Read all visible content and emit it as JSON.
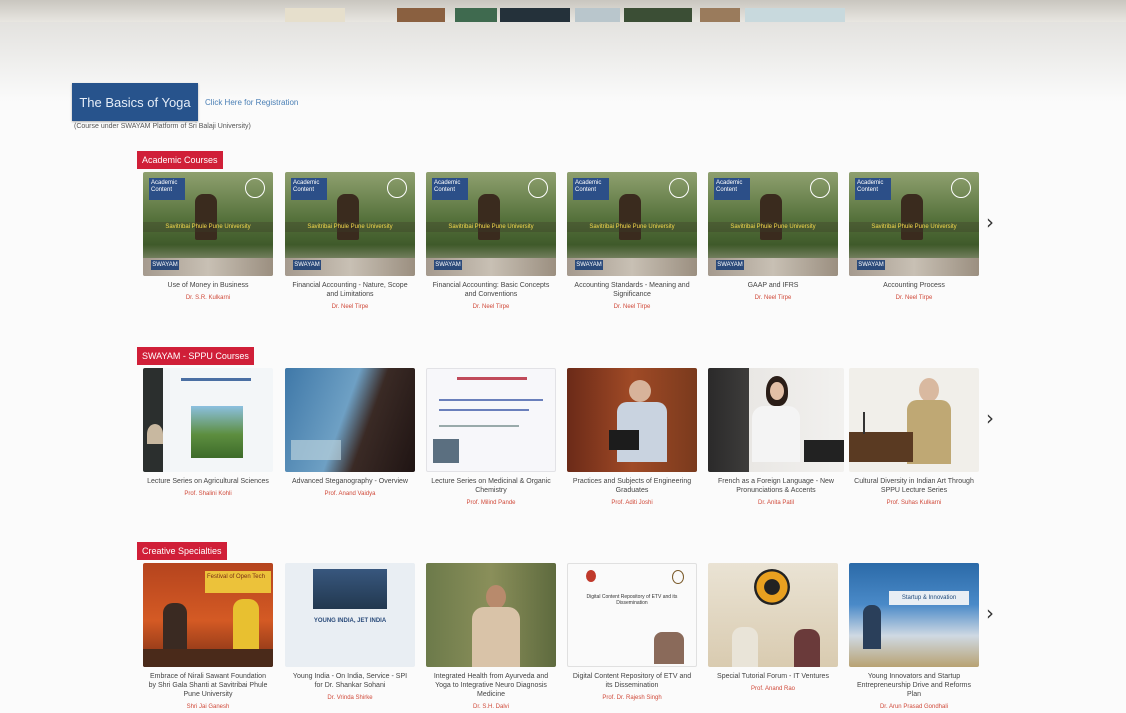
{
  "featured": {
    "banner_title": "The Basics of Yoga",
    "register_link": "Click Here for Registration",
    "subtitle": "(Course under SWAYAM Platform of Sri Balaji University)"
  },
  "sections": [
    {
      "label": "Academic Courses",
      "cards": [
        {
          "title": "Use of Money in Business",
          "author": "Dr. S.R. Kulkarni",
          "badge": "Academic Content",
          "band": "Savitribai Phule Pune University",
          "logo": "SWAYAM"
        },
        {
          "title": "Financial Accounting - Nature, Scope and Limitations",
          "author": "Dr. Neel Tirpe",
          "badge": "Academic Content",
          "band": "Savitribai Phule Pune University",
          "logo": "SWAYAM"
        },
        {
          "title": "Financial Accounting: Basic Concepts and Conventions",
          "author": "Dr. Neel Tirpe",
          "badge": "Academic Content",
          "band": "Savitribai Phule Pune University",
          "logo": "SWAYAM"
        },
        {
          "title": "Accounting Standards - Meaning and Significance",
          "author": "Dr. Neel Tirpe",
          "badge": "Academic Content",
          "band": "Savitribai Phule Pune University",
          "logo": "SWAYAM"
        },
        {
          "title": "GAAP and IFRS",
          "author": "Dr. Neel Tirpe",
          "badge": "Academic Content",
          "band": "Savitribai Phule Pune University",
          "logo": "SWAYAM"
        },
        {
          "title": "Accounting Process",
          "author": "Dr. Neel Tirpe",
          "badge": "Academic Content",
          "band": "Savitribai Phule Pune University",
          "logo": "SWAYAM"
        }
      ]
    },
    {
      "label": "SWAYAM - SPPU Courses",
      "cards": [
        {
          "title": "Lecture Series on Agricultural Sciences",
          "author": "Prof. Shalini Kohli"
        },
        {
          "title": "Advanced Steganography - Overview",
          "author": "Prof. Anand Vaidya"
        },
        {
          "title": "Lecture Series on Medicinal & Organic Chemistry",
          "author": "Prof. Milind Pande"
        },
        {
          "title": "Practices and Subjects of Engineering Graduates",
          "author": "Prof. Aditi Joshi"
        },
        {
          "title": "French as a Foreign Language - New Pronunciations & Accents",
          "author": "Dr. Anita Patil"
        },
        {
          "title": "Cultural Diversity in Indian Art Through SPPU Lecture Series",
          "author": "Prof. Suhas Kulkarni"
        }
      ]
    },
    {
      "label": "Creative Specialties",
      "cards": [
        {
          "title": "Embrace of Nirali Sawant Foundation by Shri Gala Shanti at Savitribai Phule Pune University",
          "author": "Shri Jai Ganesh",
          "banner": "Festival of Open Tech"
        },
        {
          "title": "Young India - On India, Service - SPI for Dr. Shankar Sohani",
          "author": "Dr. Vrinda Shirke",
          "banner": "YOUNG INDIA, JET INDIA"
        },
        {
          "title": "Integrated Health from Ayurveda and Yoga to Integrative Neuro Diagnosis Medicine",
          "author": "Dr. S.H. Dalvi"
        },
        {
          "title": "Digital Content Repository of ETV and its Dissemination",
          "author": "Prof. Dr. Rajesh Singh",
          "banner": "Digital Content Repository of ETV and its Dissemination"
        },
        {
          "title": "Special Tutorial Forum - IT Ventures",
          "author": "Prof. Anand Rao"
        },
        {
          "title": "Young Innovators and Startup Entrepreneurship Drive and Reforms Plan",
          "author": "Dr. Arun Prasad Gondhali",
          "banner": "Startup & Innovation"
        }
      ]
    }
  ],
  "nav": {
    "next_arrow": "›"
  },
  "colors": {
    "section_label": "#d01f38",
    "featured_banner": "#27538c",
    "author_text": "#d04a3a"
  }
}
